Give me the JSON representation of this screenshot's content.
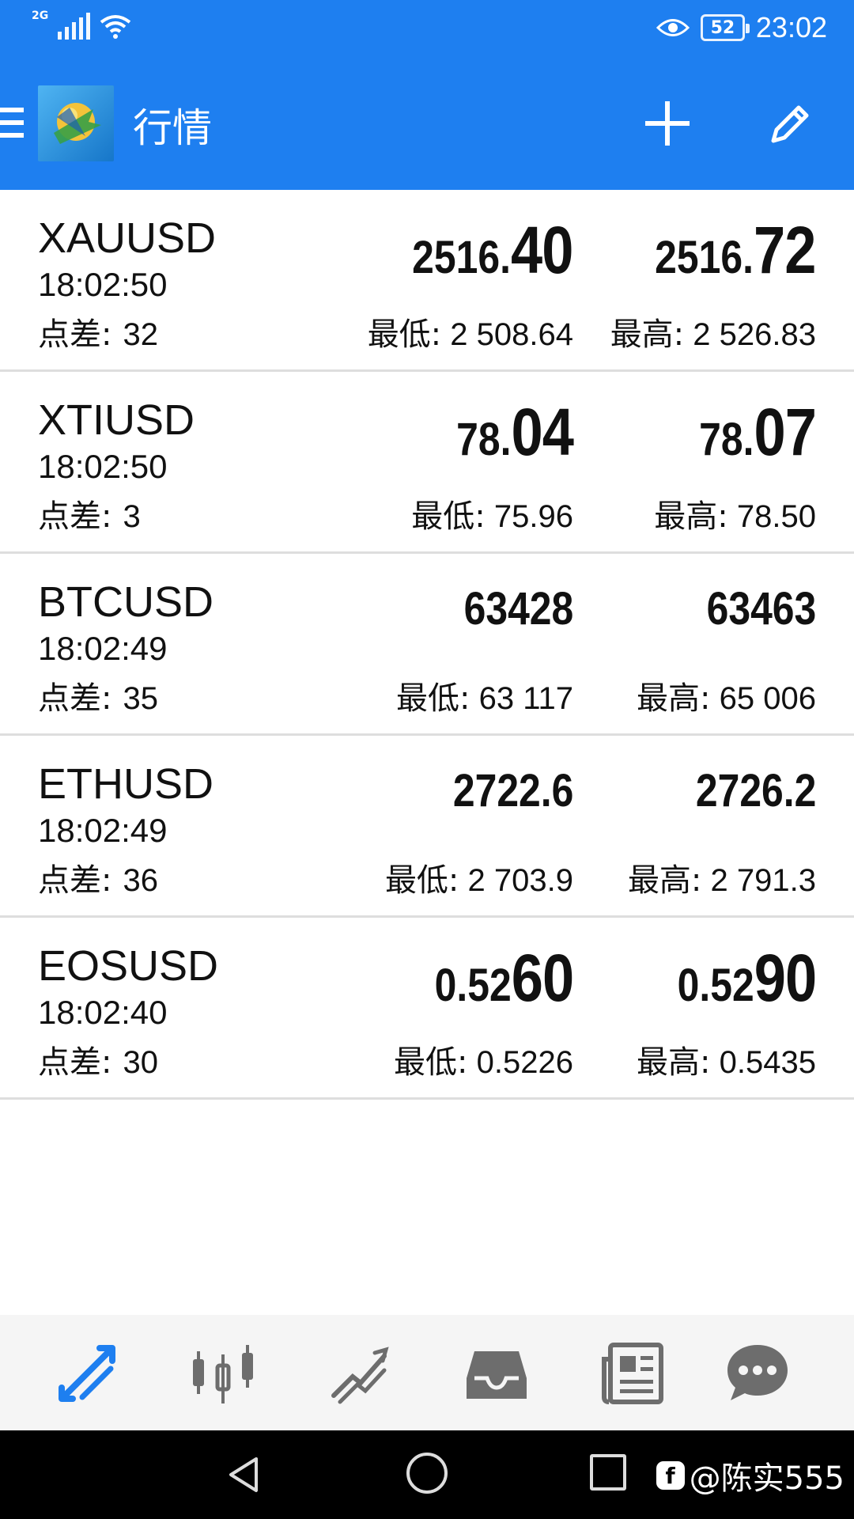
{
  "status_bar": {
    "network": "2G",
    "battery": "52",
    "time": "23:02"
  },
  "app_bar": {
    "title": "行情",
    "icons": [
      "menu-icon",
      "metatrader-logo",
      "plus-icon",
      "pencil-icon"
    ]
  },
  "quotes": [
    {
      "symbol": "XAUUSD",
      "time": "18:02:50",
      "spread_label": "点差:",
      "spread": "32",
      "bid_small": "2516.",
      "bid_big": "40",
      "ask_small": "2516.",
      "ask_big": "72",
      "low_label": "最低:",
      "low": " 2 508.64",
      "high_label": "最高:",
      "high": " 2 526.83"
    },
    {
      "symbol": "XTIUSD",
      "time": "18:02:50",
      "spread_label": "点差:",
      "spread": "3",
      "bid_small": "78.",
      "bid_big": "04",
      "ask_small": "78.",
      "ask_big": "07",
      "low_label": "最低:",
      "low": " 75.96",
      "high_label": "最高:",
      "high": " 78.50"
    },
    {
      "symbol": "BTCUSD",
      "time": "18:02:49",
      "spread_label": "点差:",
      "spread": "35",
      "bid_small": "63428",
      "bid_big": "",
      "ask_small": "63463",
      "ask_big": "",
      "low_label": "最低:",
      "low": " 63 117",
      "high_label": "最高:",
      "high": " 65 006"
    },
    {
      "symbol": "ETHUSD",
      "time": "18:02:49",
      "spread_label": "点差:",
      "spread": "36",
      "bid_small": "2722.6",
      "bid_big": "",
      "ask_small": "2726.2",
      "ask_big": "",
      "low_label": "最低:",
      "low": " 2 703.9",
      "high_label": "最高:",
      "high": " 2 791.3"
    },
    {
      "symbol": "EOSUSD",
      "time": "18:02:40",
      "spread_label": "点差:",
      "spread": "30",
      "bid_small": "0.52",
      "bid_big": "60",
      "ask_small": "0.52",
      "ask_big": "90",
      "low_label": "最低:",
      "low": " 0.5226",
      "high_label": "最高:",
      "high": " 0.5435"
    }
  ],
  "tab_bar": {
    "active_color": "#1e7ff0",
    "inactive_color": "#6d6d6d",
    "tabs": [
      "quotes-icon",
      "chart-icon",
      "trade-icon",
      "history-icon",
      "news-icon",
      "chat-icon"
    ]
  },
  "watermark": "@陈实555"
}
